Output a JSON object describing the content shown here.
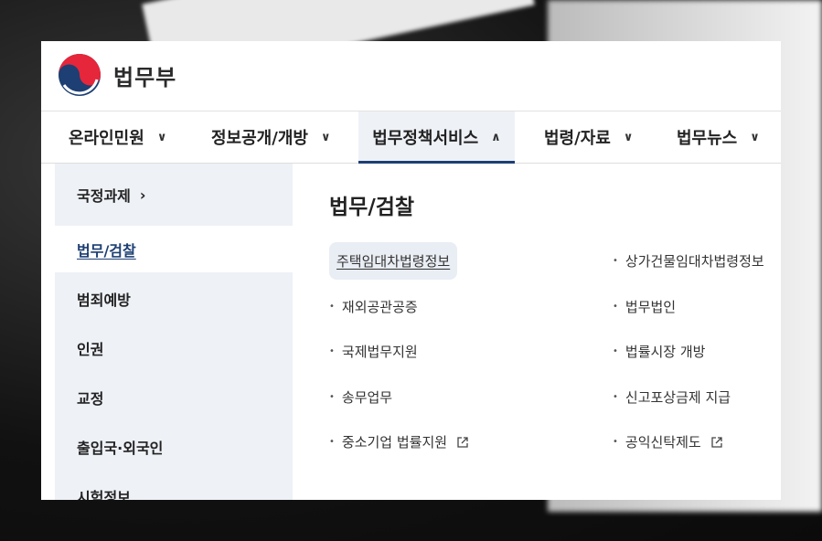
{
  "header": {
    "logo_text": "법무부"
  },
  "gnb": [
    {
      "label": "온라인민원",
      "chevron": "∨"
    },
    {
      "label": "정보공개/개방",
      "chevron": "∨"
    },
    {
      "label": "법무정책서비스",
      "chevron": "∧"
    },
    {
      "label": "법령/자료",
      "chevron": "∨"
    },
    {
      "label": "법무뉴스",
      "chevron": "∨"
    }
  ],
  "side": [
    {
      "label": "국정과제",
      "arrow": "›"
    },
    {
      "label": "법무/검찰"
    },
    {
      "label": "범죄예방"
    },
    {
      "label": "인권"
    },
    {
      "label": "교정"
    },
    {
      "label": "출입국·외국인"
    },
    {
      "label": "시험정보"
    }
  ],
  "content": {
    "title": "법무/검찰",
    "left_links": [
      {
        "label": "주택임대차법령정보"
      },
      {
        "label": "재외공관공증"
      },
      {
        "label": "국제법무지원"
      },
      {
        "label": "송무업무"
      },
      {
        "label": "중소기업 법률지원"
      }
    ],
    "right_links": [
      {
        "label": "상가건물임대차법령정보"
      },
      {
        "label": "법무법인"
      },
      {
        "label": "법률시장 개방"
      },
      {
        "label": "신고포상금제 지급"
      },
      {
        "label": "공익신탁제도"
      }
    ],
    "bullet": "•"
  }
}
